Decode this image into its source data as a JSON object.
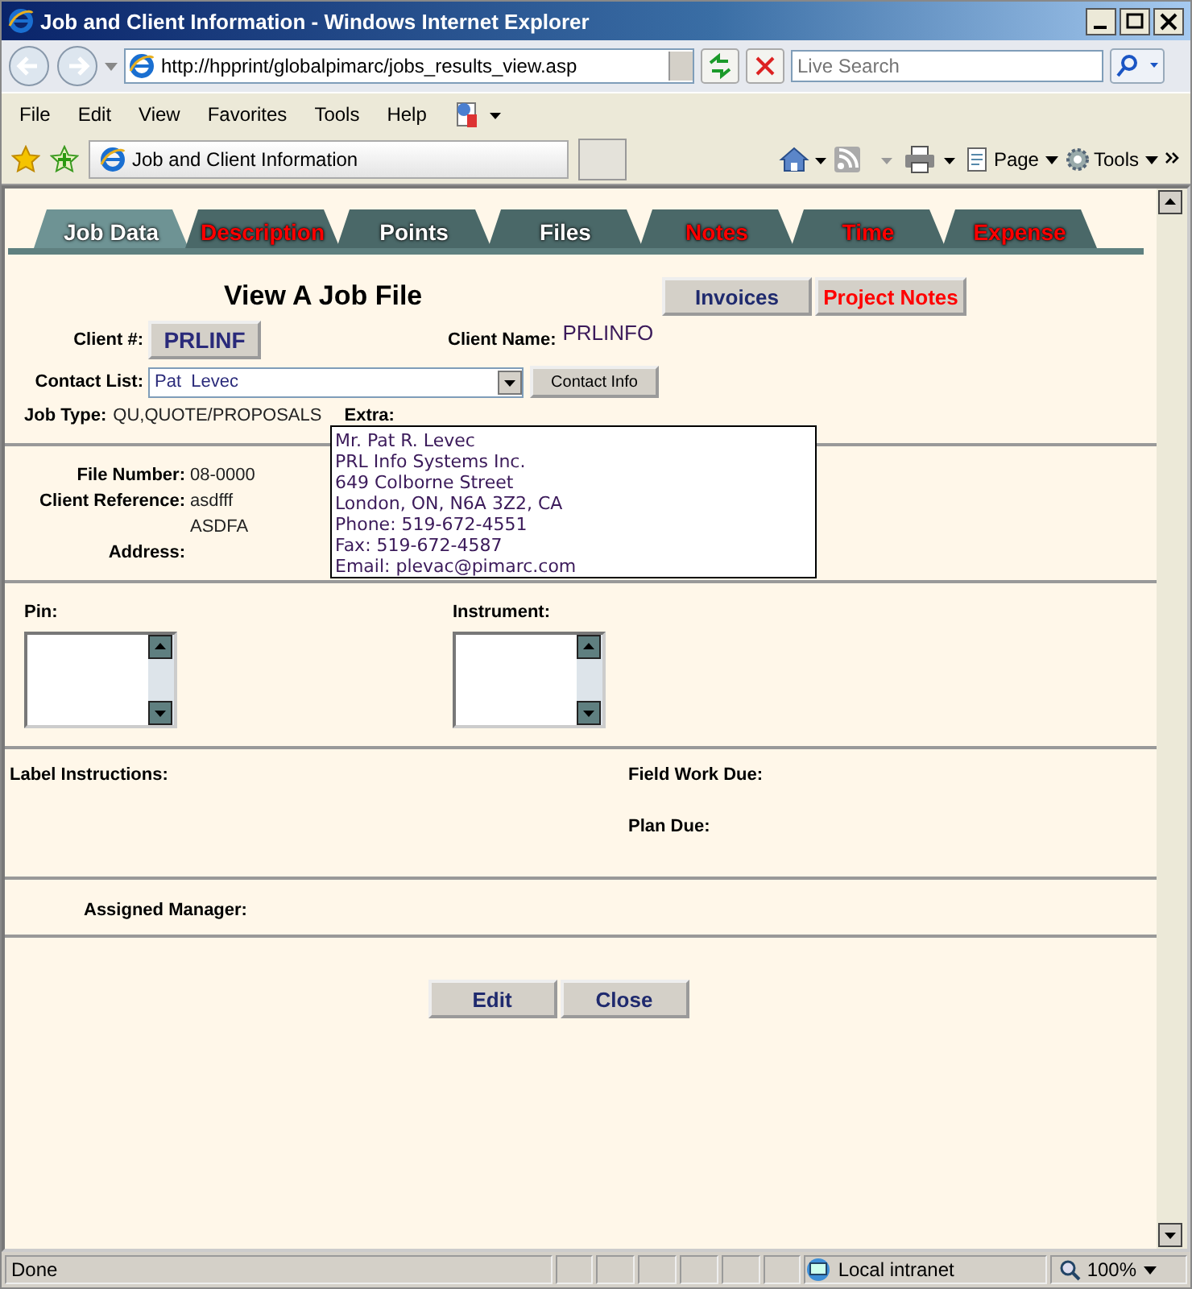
{
  "window": {
    "title": "Job and Client Information - Windows Internet Explorer"
  },
  "address_bar": {
    "url": "http://hpprint/globalpimarc/jobs_results_view.asp"
  },
  "search": {
    "placeholder": "Live Search"
  },
  "menu": [
    "File",
    "Edit",
    "View",
    "Favorites",
    "Tools",
    "Help"
  ],
  "browser_tab": {
    "title": "Job and Client Information"
  },
  "command_bar": [
    "Page",
    "Tools"
  ],
  "page_tabs": [
    {
      "label": "Job Data",
      "selected": true,
      "color": "#ffffff"
    },
    {
      "label": "Description",
      "selected": false,
      "color": "#ff0000"
    },
    {
      "label": "Points",
      "selected": false,
      "color": "#ffffff"
    },
    {
      "label": "Files",
      "selected": false,
      "color": "#ffffff"
    },
    {
      "label": "Notes",
      "selected": false,
      "color": "#ff0000"
    },
    {
      "label": "Time",
      "selected": false,
      "color": "#ff0000"
    },
    {
      "label": "Expense",
      "selected": false,
      "color": "#ff0000"
    }
  ],
  "heading": "View A Job File",
  "header_buttons": [
    {
      "label": "Invoices",
      "color": "#1f2a6e"
    },
    {
      "label": "Project Notes",
      "color": "#ff0000"
    }
  ],
  "client": {
    "label": "Client #:",
    "number": "PRLINF",
    "name_label": "Client Name:",
    "name": "PRLINFO"
  },
  "contact": {
    "label": "Contact List:",
    "value": "Pat  Levec",
    "button": "Contact Info"
  },
  "job_type": {
    "label": "Job Type:",
    "value": "QU,QUOTE/PROPOSALS",
    "extra_label": "Extra:"
  },
  "file_info": {
    "file_number_label": "File Number:",
    "file_number": "08-0000",
    "client_ref_label": "Client Reference:",
    "client_ref": "asdfff",
    "client_ref_2": "ASDFA",
    "address_label": "Address:"
  },
  "contact_popup": [
    "Mr. Pat R. Levec",
    "PRL Info Systems Inc.",
    "649 Colborne Street",
    "London, ON, N6A 3Z2, CA",
    "Phone: 519-672-4551",
    "Fax: 519-672-4587",
    "Email: plevac@pimarc.com"
  ],
  "lists": [
    {
      "label": "Pin:"
    },
    {
      "label": "Instrument:"
    }
  ],
  "label_instructions": "Label Instructions:",
  "field_work_due": "Field Work Due:",
  "plan_due": "Plan Due:",
  "assigned_manager": "Assigned Manager:",
  "footer_buttons": [
    "Edit",
    "Close"
  ],
  "status_bar": {
    "text": "Done",
    "zone": "Local intranet",
    "zoom": "100%"
  }
}
